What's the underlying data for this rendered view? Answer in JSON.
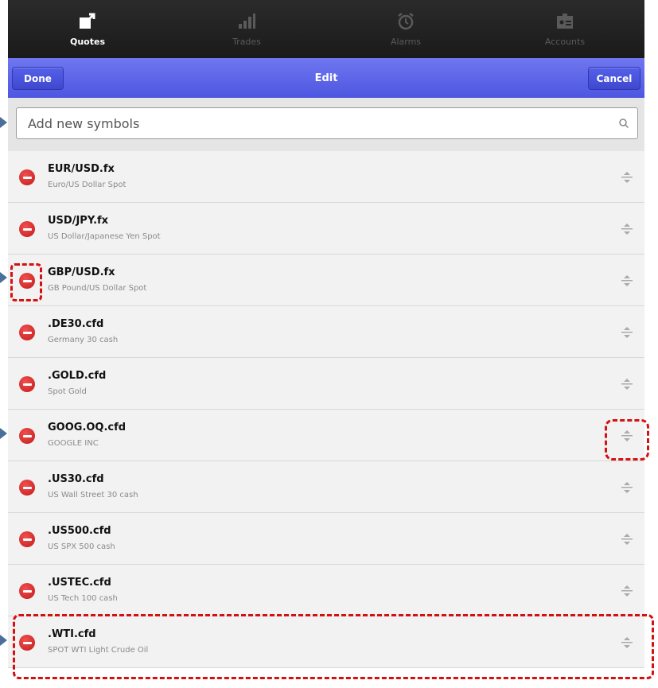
{
  "tabs": [
    {
      "label": "Quotes",
      "icon": "quotes-icon",
      "active": true
    },
    {
      "label": "Trades",
      "icon": "trades-icon",
      "active": false
    },
    {
      "label": "Alarms",
      "icon": "alarm-clock-icon",
      "active": false
    },
    {
      "label": "Accounts",
      "icon": "accounts-icon",
      "active": false
    }
  ],
  "actionbar": {
    "done_label": "Done",
    "title": "Edit",
    "cancel_label": "Cancel"
  },
  "search": {
    "placeholder": "Add new symbols",
    "value": ""
  },
  "symbols": [
    {
      "symbol": "EUR/USD.fx",
      "description": "Euro/US Dollar Spot"
    },
    {
      "symbol": "USD/JPY.fx",
      "description": "US Dollar/Japanese Yen Spot"
    },
    {
      "symbol": "GBP/USD.fx",
      "description": "GB Pound/US Dollar Spot"
    },
    {
      "symbol": ".DE30.cfd",
      "description": "Germany 30 cash"
    },
    {
      "symbol": ".GOLD.cfd",
      "description": "Spot Gold"
    },
    {
      "symbol": "GOOG.OQ.cfd",
      "description": "GOOGLE INC"
    },
    {
      "symbol": ".US30.cfd",
      "description": "US Wall Street 30 cash"
    },
    {
      "symbol": ".US500.cfd",
      "description": "US SPX 500 cash"
    },
    {
      "symbol": ".USTEC.cfd",
      "description": "US Tech 100 cash"
    },
    {
      "symbol": ".WTI.cfd",
      "description": "SPOT WTI Light Crude Oil"
    }
  ],
  "colors": {
    "accent": "#5a63e8",
    "highlight": "#d41010",
    "remove": "#d42020"
  }
}
